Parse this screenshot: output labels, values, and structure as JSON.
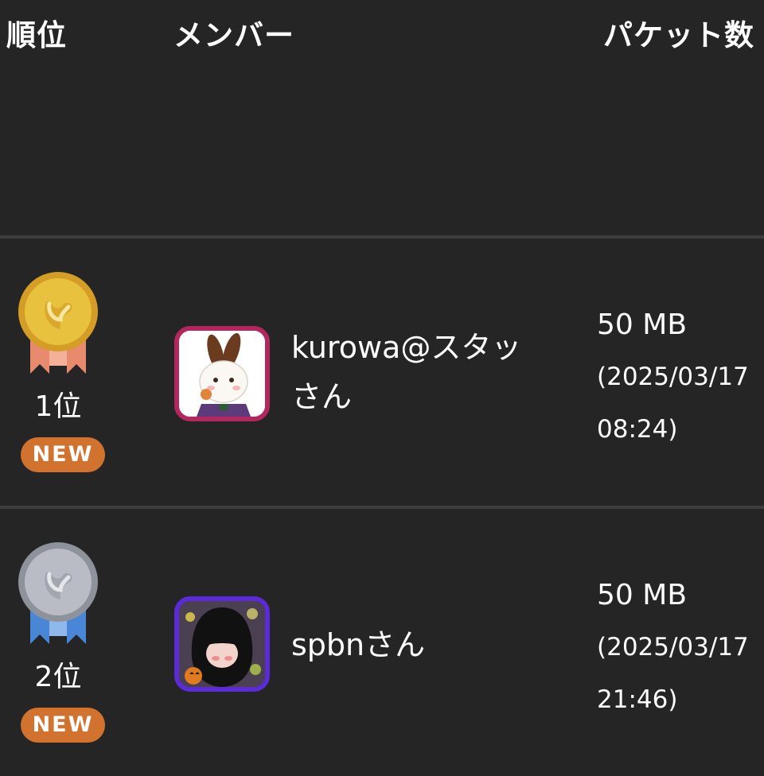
{
  "header": {
    "rank": "順位",
    "member": "メンバー",
    "packets": "パケット数"
  },
  "rows": [
    {
      "rank": "1位",
      "medal": "gold-medal-icon",
      "badge": "NEW",
      "member_name": "kurowa@スタッさん",
      "packets": "50 MB",
      "timestamp_line1": "(2025/03/17",
      "timestamp_line2": "08:24)"
    },
    {
      "rank": "2位",
      "medal": "silver-medal-icon",
      "badge": "NEW",
      "member_name": "spbnさん",
      "packets": "50 MB",
      "timestamp_line1": "(2025/03/17",
      "timestamp_line2": "21:46)"
    }
  ],
  "colors": {
    "background": "#252525",
    "divider": "#3d3d3d",
    "badge": "#d1722e",
    "gold": "#e8c13f",
    "silver": "#b9bcc4",
    "avatar_border_1": "#b3275e",
    "avatar_border_2": "#5b2bd6"
  }
}
